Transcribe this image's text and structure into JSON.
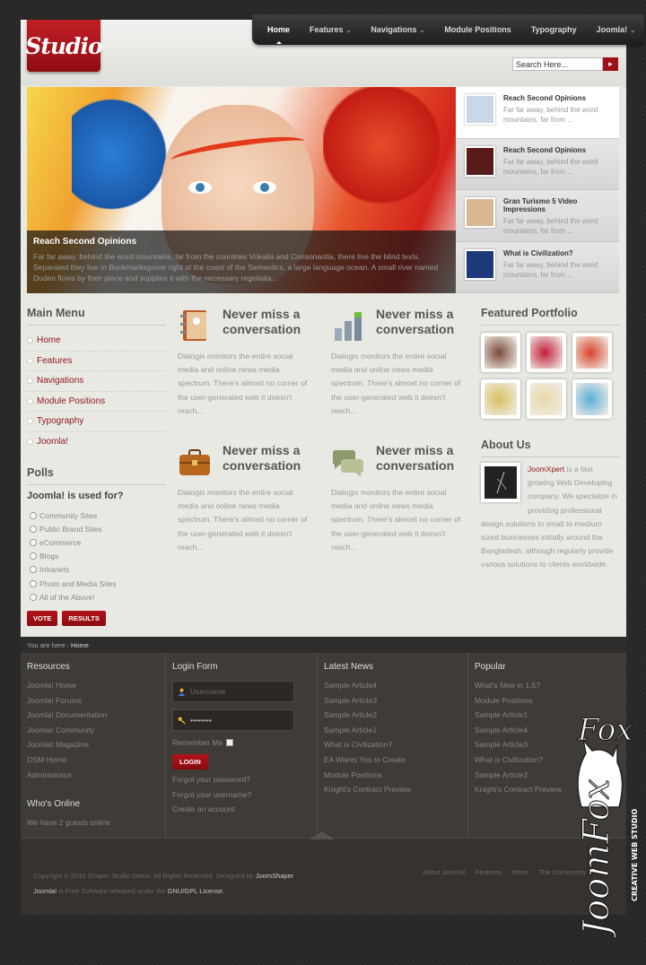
{
  "logo": {
    "text": "Studio"
  },
  "nav": {
    "items": [
      {
        "label": "Home",
        "active": true,
        "dropdown": false
      },
      {
        "label": "Features",
        "active": false,
        "dropdown": true
      },
      {
        "label": "Navigations",
        "active": false,
        "dropdown": true
      },
      {
        "label": "Module Positions",
        "active": false,
        "dropdown": false
      },
      {
        "label": "Typography",
        "active": false,
        "dropdown": false
      },
      {
        "label": "Joomla!",
        "active": false,
        "dropdown": true
      }
    ]
  },
  "search": {
    "value": "Search Here...",
    "button_icon": "search-go-icon"
  },
  "slider": {
    "caption": {
      "title": "Reach Second Opinions",
      "text": "Far far away, behind the word mountains, far from the countries Vokalia and Consonantia, there live the blind texts. Separated they live in Bookmarksgrove right at the coast of the Semantics, a large language ocean. A small river named Duden flows by their place and supplies it with the necessary regelialia..."
    },
    "thumbs": [
      {
        "title": "Reach Second Opinions",
        "text": "Far far away, behind the word mountains, far from ...",
        "active": true,
        "color": "#c8d8e8"
      },
      {
        "title": "Reach Second Opinions",
        "text": "Far far away, behind the word mountains, far from ...",
        "active": false,
        "color": "#5a1a1a"
      },
      {
        "title": "Gran Turismo 5 Video Impressions",
        "text": "Far far away, behind the word mountains, far from ...",
        "active": false,
        "color": "#d8b890"
      },
      {
        "title": "What is Civilization?",
        "text": "Far far away, behind the word mountains, far from ...",
        "active": false,
        "color": "#1a3a7a"
      }
    ]
  },
  "main_menu": {
    "title": "Main Menu",
    "items": [
      "Home",
      "Features",
      "Navigations",
      "Module Positions",
      "Typography",
      "Joomla!"
    ]
  },
  "polls": {
    "title": "Polls",
    "question": "Joomla! is used for?",
    "options": [
      "Community Sites",
      "Public Brand Sites",
      "eCommerce",
      "Blogs",
      "Intranets",
      "Photo and Media Sites",
      "All of the Above!"
    ],
    "vote_label": "VOTE",
    "results_label": "RESULTS"
  },
  "features": [
    {
      "title": "Never miss a conversation",
      "icon": "address-book-icon",
      "text": "Dialogix monitors the entire social media and online news media spectrum. There's almost no corner of the user-generated web it doesn't reach..."
    },
    {
      "title": "Never miss a conversation",
      "icon": "bar-chart-icon",
      "text": "Dialogix monitors the entire social media and online news media spectrum. There's almost no corner of the user-generated web it doesn't reach..."
    },
    {
      "title": "Never miss a conversation",
      "icon": "briefcase-icon",
      "text": "Dialogix monitors the entire social media and online news media spectrum. There's almost no corner of the user-generated web it doesn't reach..."
    },
    {
      "title": "Never miss a conversation",
      "icon": "chat-bubbles-icon",
      "text": "Dialogix monitors the entire social media and online news media spectrum. There's almost no corner of the user-generated web it doesn't reach..."
    }
  ],
  "portfolio": {
    "title": "Featured Portfolio",
    "items": [
      {
        "name": "portfolio-food",
        "color": "#7a4a3a"
      },
      {
        "name": "portfolio-raspberries",
        "color": "#c21e3a"
      },
      {
        "name": "portfolio-butterfly",
        "color": "#d8442a"
      },
      {
        "name": "portfolio-pears",
        "color": "#d8c060"
      },
      {
        "name": "portfolio-dessert",
        "color": "#e8d8a8"
      },
      {
        "name": "portfolio-beach",
        "color": "#5ab0d8"
      }
    ]
  },
  "about": {
    "title": "About Us",
    "brand": "JoomXpert",
    "text": " is a fast growing Web Developing company. We specialize in providing professional design solutions to small to medium sized businesses initially around the Bangladesh, although regularly provide various solutions to clients worldwide."
  },
  "breadcrumb": {
    "prefix": "You are here :",
    "current": "Home"
  },
  "footer": {
    "resources": {
      "title": "Resources",
      "links": [
        "Joomla! Home",
        "Joomla! Forums",
        "Joomla! Documentation",
        "Joomla! Community",
        "Joomla! Magazine",
        "OSM Home",
        "Administrator"
      ]
    },
    "whos_online": {
      "title": "Who's Online",
      "text": "We have 2 guests online"
    },
    "login": {
      "title": "Login Form",
      "username_placeholder": "Username",
      "password_value": "••••••••",
      "remember_label": "Remember Me",
      "button_label": "LOGIN",
      "links": [
        "Forgot your password?",
        "Forgot your username?",
        "Create an account"
      ]
    },
    "latest_news": {
      "title": "Latest News",
      "links": [
        "Sample Article4",
        "Sample Article3",
        "Sample Article2",
        "Sample Article1",
        "What is Civilization?",
        "EA Wants You to Create",
        "Module Positions",
        "Knight's Contract Preview"
      ]
    },
    "popular": {
      "title": "Popular",
      "links": [
        "What's New in 1.5?",
        "Module Positions",
        "Sample Article1",
        "Sample Article4",
        "Sample Article3",
        "What is Civilization?",
        "Sample Article2",
        "Knight's Contract Preview"
      ]
    }
  },
  "bottom": {
    "copyright_1": "Copyright © 2010 Shaper Studio Demo. All Rights Reserved. Designed by ",
    "copyright_brand": "JoomShaper",
    "copyright_2a": "Joomla!",
    "copyright_2b": " is Free Software released under the ",
    "copyright_2c": "GNU/GPL License.",
    "links": [
      "About Joomla!",
      "Features",
      "News",
      "The Community"
    ]
  },
  "watermark": {
    "brand": "JoomFox",
    "tagline": "CREATIVE WEB STUDIO"
  }
}
